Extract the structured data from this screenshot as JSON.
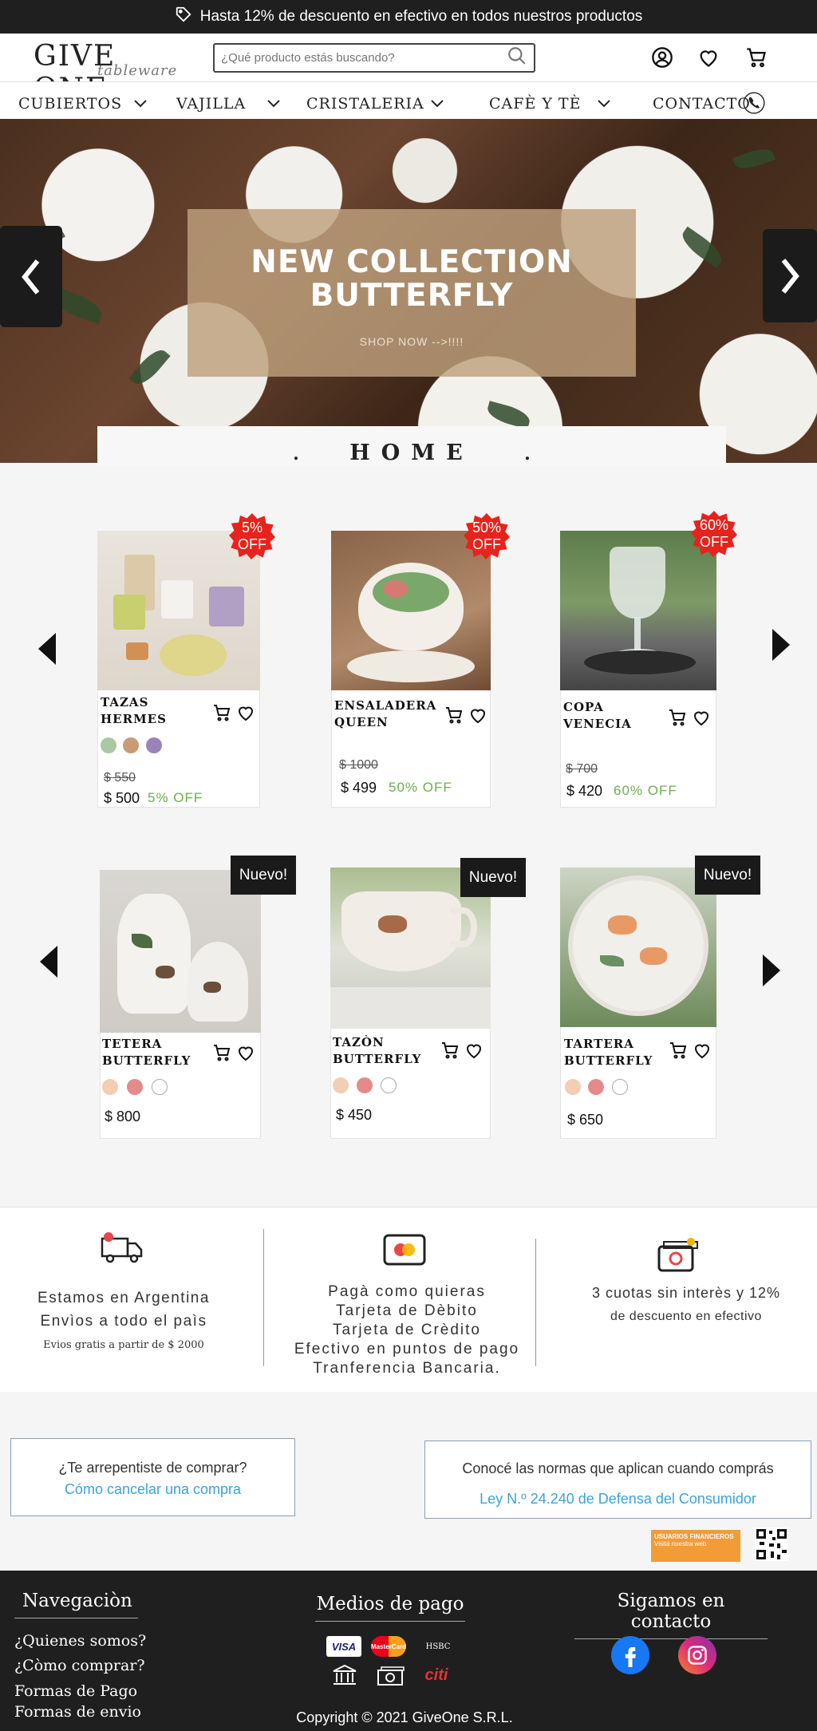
{
  "promo": {
    "text": "Hasta 12% de descuento en efectivo en todos nuestros productos"
  },
  "header": {
    "logo_main": "GIVE ONE",
    "logo_sub": "tableware",
    "search_placeholder": "¿Qué producto estás buscando?"
  },
  "nav": {
    "items": [
      {
        "label": "CUBIERTOS"
      },
      {
        "label": "VAJILLA"
      },
      {
        "label": "CRISTALERIA"
      },
      {
        "label": "CAFÈ Y TÈ"
      },
      {
        "label": "CONTACTO"
      }
    ]
  },
  "hero": {
    "title_line1": "NEW COLLECTION",
    "title_line2": "BUTTERFLY",
    "cta": "SHOP NOW -->!!!!"
  },
  "home": {
    "title": "HOME",
    "dot": "."
  },
  "colors": {
    "discount_red": "#e8221c",
    "off_green": "#6ab04c",
    "dark": "#1f1f1f",
    "link_blue": "#3aa3d8"
  },
  "products_sale": [
    {
      "name_line1": "TAZAS",
      "name_line2": "HERMES",
      "badge_line1": "5%",
      "badge_line2": "OFF",
      "old_price": "$ 550",
      "price": "$ 500",
      "off": "5% OFF",
      "swatches": [
        "#a9c9a4",
        "#c99a76",
        "#9c83b7"
      ]
    },
    {
      "name_line1": "ENSALADERA",
      "name_line2": "QUEEN",
      "badge_line1": "50%",
      "badge_line2": "OFF",
      "old_price": "$ 1000",
      "price": "$ 499",
      "off": "50% OFF",
      "swatches": []
    },
    {
      "name_line1": "COPA",
      "name_line2": "VENECIA",
      "badge_line1": "60%",
      "badge_line2": "OFF",
      "old_price": "$ 700",
      "price": "$ 420",
      "off": "60% OFF",
      "swatches": []
    }
  ],
  "products_new": [
    {
      "name_line1": "TETERA",
      "name_line2": "BUTTERFLY",
      "badge": "Nuevo!",
      "price": "$ 800",
      "swatches": [
        "#f3cdb4",
        "#e58a8a",
        "#ffffff"
      ]
    },
    {
      "name_line1": "TAZÒN",
      "name_line2": "BUTTERFLY",
      "badge": "Nuevo!",
      "price": "$ 450",
      "swatches": [
        "#f3cdb4",
        "#e58a8a",
        "#ffffff"
      ]
    },
    {
      "name_line1": "TARTERA",
      "name_line2": "BUTTERFLY",
      "badge": "Nuevo!",
      "price": "$ 650",
      "swatches": [
        "#f3cdb4",
        "#e58a8a",
        "#ffffff"
      ]
    }
  ],
  "features": {
    "shipping_line1": "Estamos en Argentina",
    "shipping_line2": "Envìos a todo el paìs",
    "shipping_note": "Evios gratis a partir de $ 2000",
    "pay_line1": "Pagà como quieras",
    "pay_line2": "Tarjeta de Dèbito",
    "pay_line3": "Tarjeta de Crèdito",
    "pay_line4": "Efectivo en puntos de pago",
    "pay_line5": "Tranferencia Bancaria.",
    "cuotas_line1": "3  cuotas sin interès y 12%",
    "cuotas_line2": "de descuento en efectivo"
  },
  "info": {
    "regret_title": "¿Te arrepentiste de comprar?",
    "regret_link": "Cómo cancelar una compra",
    "norms_title": "Conocé las normas que aplican cuando comprás",
    "norms_link": "Ley N.º 24.240 de Defensa del Consumidor",
    "usuarios_title": "USUARIOS FINANCIEROS",
    "usuarios_sub": "Visitá nuestra web"
  },
  "footer": {
    "nav_title": "Navegaciòn",
    "nav_links": [
      "¿Quienes somos?",
      "¿Còmo comprar?",
      "Formas de Pago",
      "Formas de envio"
    ],
    "pay_title": "Medios de pago",
    "pay_visa": "VISA",
    "pay_master": "MasterCard",
    "pay_hsbc": "HSBC",
    "pay_citi": "citi",
    "social_title": "Sigamos en contacto",
    "copyright": "Copyright © 2021 GiveOne   S.R.L."
  }
}
